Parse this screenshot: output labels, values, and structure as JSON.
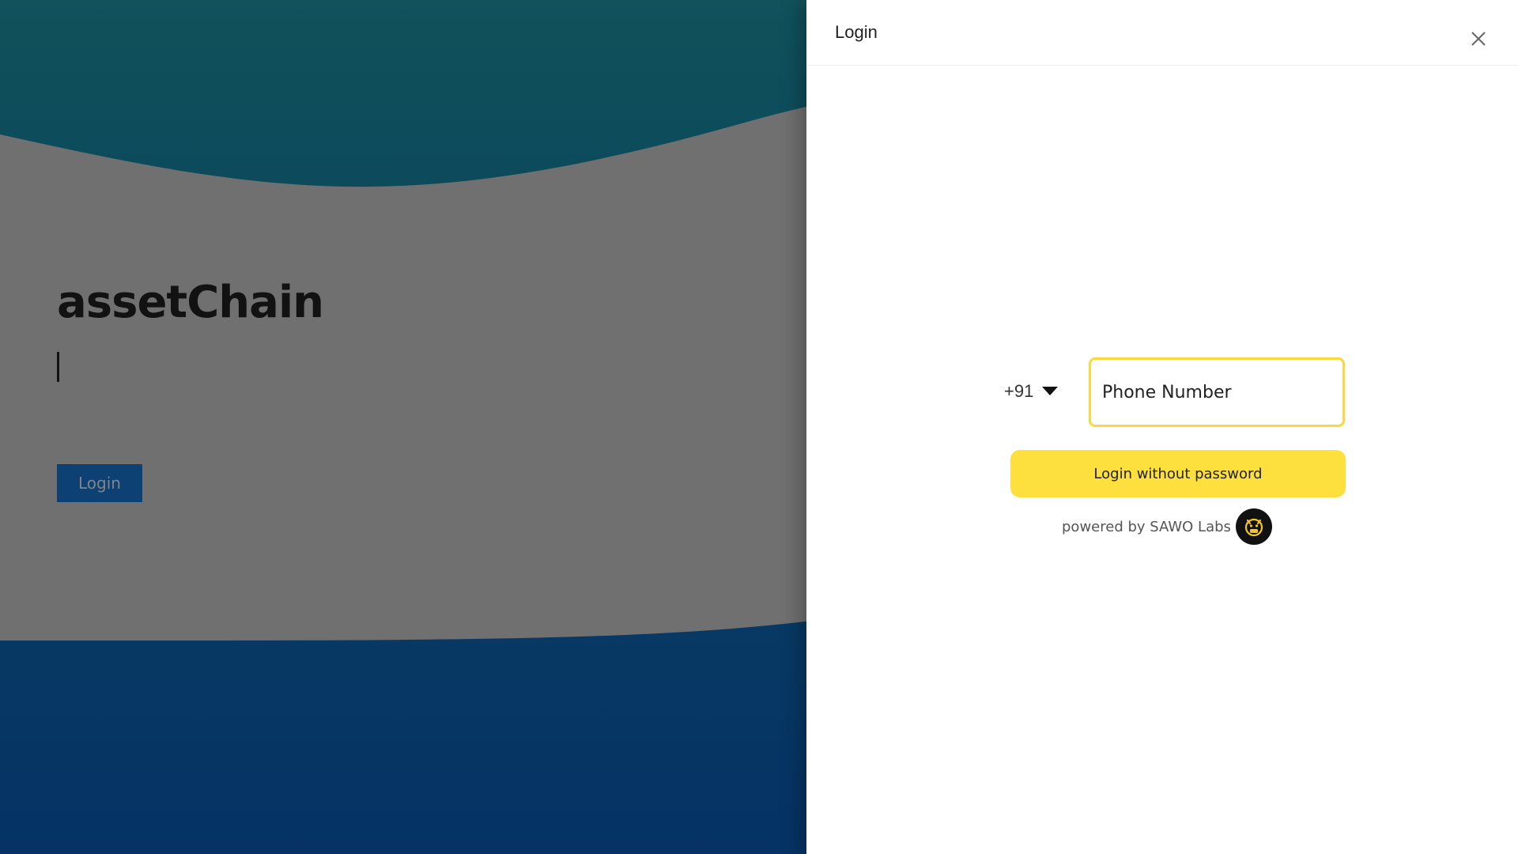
{
  "background_page": {
    "title": "assetChain",
    "login_label": "Login"
  },
  "drawer": {
    "title": "Login",
    "close_icon": "close-icon",
    "country_code": "+91",
    "caret_icon": "caret-down-icon",
    "phone_placeholder": "Phone Number",
    "phone_value": "",
    "submit_label": "Login without password",
    "powered_by": "powered by SAWO Labs",
    "logo_name": "sawo-logo"
  },
  "colors": {
    "accent_yellow": "#fddf3d",
    "input_border": "#fbd93d",
    "hero_button": "#1877d2"
  }
}
